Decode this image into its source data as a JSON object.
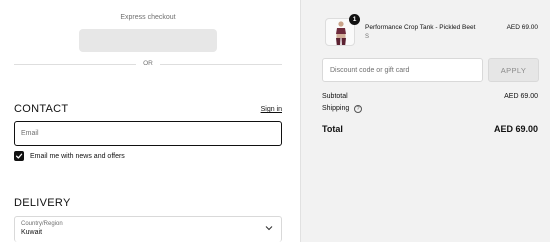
{
  "express": {
    "label": "Express checkout",
    "or_text": "OR"
  },
  "contact": {
    "title": "CONTACT",
    "signin_label": "Sign in",
    "email_placeholder": "Email",
    "newsletter_label": "Email me with news and offers",
    "newsletter_checked": true
  },
  "delivery": {
    "title": "DELIVERY",
    "country_label": "Country/Region",
    "country_value": "Kuwait"
  },
  "order": {
    "item": {
      "quantity": "1",
      "name": "Performance Crop Tank - Pickled Beet",
      "variant": "S",
      "price": "AED 69.00"
    },
    "discount_placeholder": "Discount code or gift card",
    "apply_label": "APPLY",
    "subtotal_label": "Subtotal",
    "subtotal_value": "AED 69.00",
    "shipping_label": "Shipping",
    "total_label": "Total",
    "total_value": "AED 69.00"
  },
  "colors": {
    "accent": "#111111",
    "sidebar_bg": "#f2f2f2",
    "product_color": "#6e2a3c"
  },
  "icons": {
    "check": "checkmark-icon",
    "chevron": "chevron-down-icon",
    "info": "info-icon"
  }
}
